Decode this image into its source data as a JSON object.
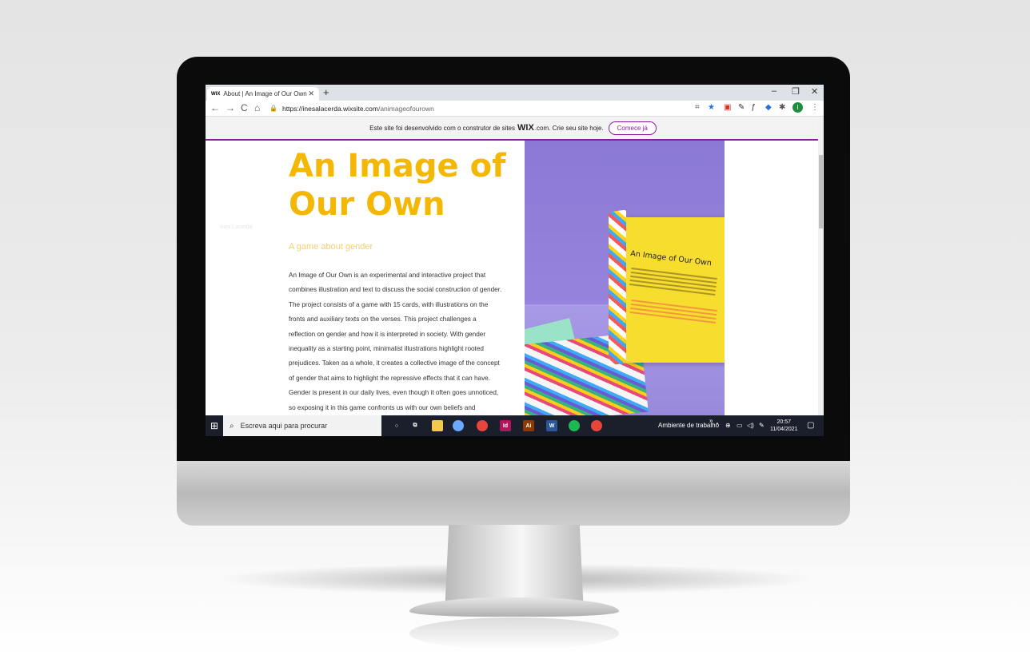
{
  "browser": {
    "tab": {
      "favicon": "WIX",
      "title": "About | An Image of Our Own",
      "close": "✕"
    },
    "new_tab": "+",
    "window_controls": {
      "minimize": "–",
      "restore": "❐",
      "close": "✕"
    },
    "nav": {
      "back": "←",
      "forward": "→",
      "reload": "C",
      "home": "⌂"
    },
    "url": {
      "lock": "🔒",
      "host": "https://inesalacerda.wixsite.com",
      "path": "/animageofourown"
    },
    "extensions": [
      "qr-icon",
      "star-icon",
      "pocket-icon",
      "pen-icon",
      "f-icon",
      "graduation-icon",
      "puzzle-icon",
      "profile-icon",
      "menu-icon"
    ],
    "profile_initial": "I",
    "menu": "⋮"
  },
  "wix_banner": {
    "text_before": "Este site foi desenvolvido com o construtor de sites",
    "wix_logo": "WIX",
    "text_after": ".com. Crie seu site hoje.",
    "cta": "Comece já"
  },
  "page": {
    "title": "An Image of Our Own",
    "subtitle": "A game about gender",
    "faint_label": "Ines Lacerda",
    "body": "An Image of Our Own is an experimental and interactive project that combines illustration and text to discuss the social construction of gender. The project consists of a game with 15 cards, with illustrations on the fronts and auxiliary texts on the verses. This project challenges a reflection on gender and how it is interpreted in society. With gender inequality as a starting point, minimalist illustrations highlight rooted prejudices. Taken as a whole, it creates a collective image of the concept of gender that aims to highlight the repressive effects that it can have. Gender is present in our daily lives, even though it often goes unnoticed, so exposing it in this game confronts us with our own beliefs and behaviors. In an informal and accessible language, starting points are given to start a",
    "photo_box_title": "An Image of Our Own"
  },
  "taskbar": {
    "search_placeholder": "Escreva aqui para procurar",
    "apps": [
      {
        "name": "cortana-icon",
        "glyph": "○",
        "color": "#1a1f2b"
      },
      {
        "name": "task-view-icon",
        "glyph": "⧉",
        "color": "#1a1f2b"
      },
      {
        "name": "file-explorer-icon",
        "glyph": "",
        "color": "#f2c94c"
      },
      {
        "name": "paint-icon",
        "glyph": "",
        "color": "#6aa9ff"
      },
      {
        "name": "chrome-icon",
        "glyph": "",
        "color": "#e8453c"
      },
      {
        "name": "indesign-icon",
        "glyph": "Id",
        "color": "#b0165a"
      },
      {
        "name": "illustrator-icon",
        "glyph": "Ai",
        "color": "#8a3b00"
      },
      {
        "name": "word-icon",
        "glyph": "W",
        "color": "#2b579a"
      },
      {
        "name": "spotify-icon",
        "glyph": "",
        "color": "#1db954"
      },
      {
        "name": "chrome-active-icon",
        "glyph": "",
        "color": "#e8453c"
      }
    ],
    "desktop_label": "Ambiente de trabalho",
    "time": "20:57",
    "date": "11/04/2021"
  }
}
